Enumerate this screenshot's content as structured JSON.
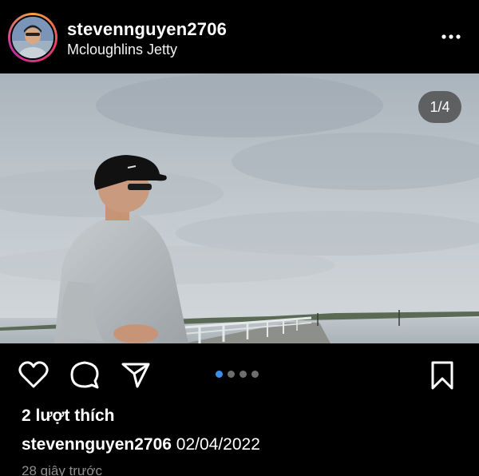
{
  "post": {
    "username": "stevennguyen2706",
    "location": "Mcloughlins Jetty",
    "photo_counter": "1/4",
    "carousel_total": 4,
    "carousel_active": 1,
    "likes_text": "2 lượt thích",
    "caption_user": "stevennguyen2706",
    "caption_text": "02/04/2022",
    "time_text": "28 giây trước"
  },
  "icons": {
    "more": "more-horizontal-icon",
    "like": "heart-icon",
    "comment": "comment-icon",
    "share": "send-icon",
    "save": "bookmark-icon"
  },
  "colors": {
    "background": "#000000",
    "text": "#ffffff",
    "muted": "#8e8e8e",
    "active_dot": "#3b8eea"
  }
}
